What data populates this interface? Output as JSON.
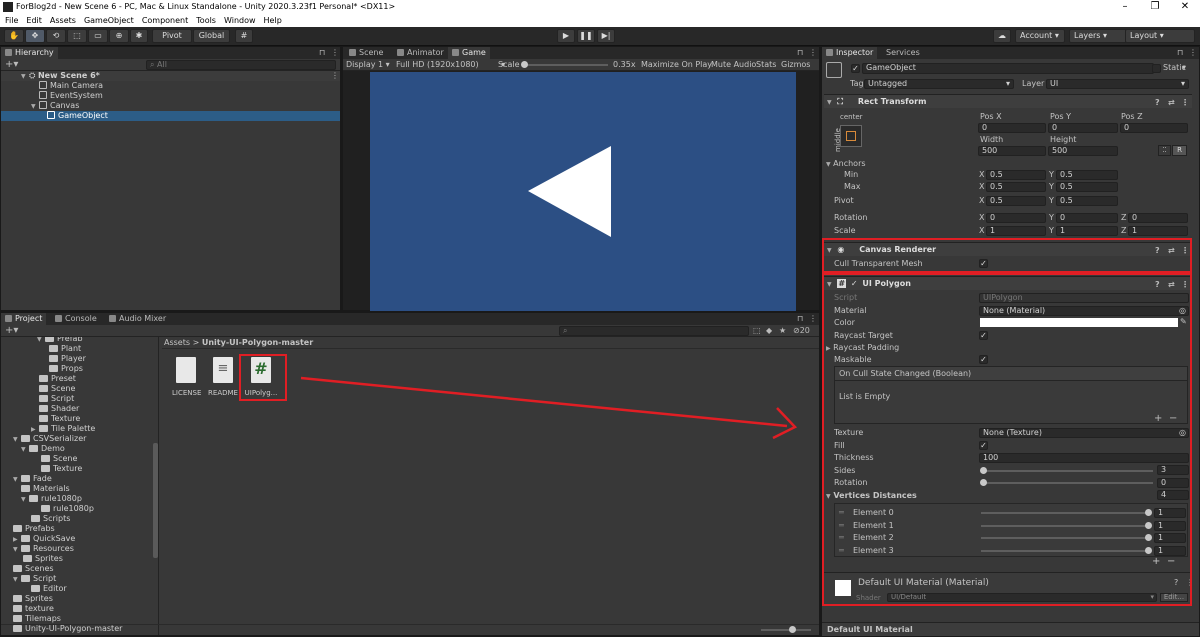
{
  "window": {
    "title": "ForBlog2d - New Scene 6 - PC, Mac & Linux Standalone - Unity 2020.3.23f1 Personal* <DX11>"
  },
  "menu": [
    "File",
    "Edit",
    "Assets",
    "GameObject",
    "Component",
    "Tools",
    "Window",
    "Help"
  ],
  "toolbar": {
    "pivot": "Pivot",
    "global": "Global",
    "account": "Account",
    "layers": "Layers",
    "layout": "Layout"
  },
  "hierarchy": {
    "tab": "Hierarchy",
    "search_placeholder": "All",
    "scene": "New Scene 6*",
    "items": [
      "Main Camera",
      "EventSystem",
      "Canvas",
      "GameObject"
    ]
  },
  "center_tabs": {
    "scene": "Scene",
    "animator": "Animator",
    "game": "Game"
  },
  "game": {
    "display": "Display 1",
    "resolution": "Full HD (1920x1080)",
    "scale_label": "Scale",
    "scale_value": "0.35x",
    "maximize": "Maximize On Play",
    "mute": "Mute Audio",
    "stats": "Stats",
    "gizmos": "Gizmos",
    "bg_color": "#2c4f84"
  },
  "project": {
    "tabs": [
      "Project",
      "Console",
      "Audio Mixer"
    ],
    "tree": [
      "Prefab",
      "Plant",
      "Player",
      "Props",
      "Preset",
      "Scene",
      "Script",
      "Shader",
      "Texture",
      "Tile Palette",
      "CSVSerializer",
      "Demo",
      "Scene",
      "Texture",
      "Fade",
      "Materials",
      "rule1080p",
      "rule1080p",
      "Scripts",
      "Prefabs",
      "QuickSave",
      "Resources",
      "Sprites",
      "Scenes",
      "Script",
      "Editor",
      "Sprites",
      "texture",
      "Tilemaps",
      "Unity-UI-Polygon-master"
    ],
    "breadcrumb_root": "Assets",
    "breadcrumb_leaf": "Unity-UI-Polygon-master",
    "files": [
      {
        "name": "LICENSE"
      },
      {
        "name": "README"
      },
      {
        "name": "UIPolyg..."
      }
    ],
    "count": "20"
  },
  "inspector": {
    "tabs": [
      "Inspector",
      "Services"
    ],
    "object_name": "GameObject",
    "static_label": "Static",
    "tag_label": "Tag",
    "tag_value": "Untagged",
    "layer_label": "Layer",
    "layer_value": "UI",
    "rect_transform": {
      "title": "Rect Transform",
      "anchor_h": "center",
      "anchor_v": "middle",
      "pos_x_label": "Pos X",
      "pos_y_label": "Pos Y",
      "pos_z_label": "Pos Z",
      "pos_x": "0",
      "pos_y": "0",
      "pos_z": "0",
      "width_label": "Width",
      "height_label": "Height",
      "width": "500",
      "height": "500",
      "r_btn": "R",
      "anchors_label": "Anchors",
      "min_label": "Min",
      "max_label": "Max",
      "min_x": "0.5",
      "min_y": "0.5",
      "max_x": "0.5",
      "max_y": "0.5",
      "pivot_label": "Pivot",
      "pivot_x": "0.5",
      "pivot_y": "0.5",
      "rotation_label": "Rotation",
      "rot_x": "0",
      "rot_y": "0",
      "rot_z": "0",
      "scale_label": "Scale",
      "scale_x": "1",
      "scale_y": "1",
      "scale_z": "1",
      "axis_x": "X",
      "axis_y": "Y",
      "axis_z": "Z"
    },
    "canvas_renderer": {
      "title": "Canvas Renderer",
      "cull_label": "Cull Transparent Mesh"
    },
    "ui_polygon": {
      "title": "UI Polygon",
      "script_label": "Script",
      "script_value": "UIPolygon",
      "material_label": "Material",
      "material_value": "None (Material)",
      "color_label": "Color",
      "raycast_target_label": "Raycast Target",
      "raycast_padding_label": "Raycast Padding",
      "maskable_label": "Maskable",
      "event_title": "On Cull State Changed (Boolean)",
      "event_empty": "List is Empty",
      "texture_label": "Texture",
      "texture_value": "None (Texture)",
      "fill_label": "Fill",
      "thickness_label": "Thickness",
      "thickness_value": "100",
      "sides_label": "Sides",
      "sides_value": "3",
      "rotation_label": "Rotation",
      "rotation_value": "0",
      "vertices_label": "Vertices Distances",
      "vertices_count": "4",
      "elements": [
        {
          "label": "Element 0",
          "value": "1"
        },
        {
          "label": "Element 1",
          "value": "1"
        },
        {
          "label": "Element 2",
          "value": "1"
        },
        {
          "label": "Element 3",
          "value": "1"
        }
      ]
    },
    "material": {
      "title": "Default UI Material (Material)",
      "shader_label": "Shader",
      "shader_value": "UI/Default",
      "edit": "Edit..."
    },
    "footer": "Default UI Material"
  }
}
